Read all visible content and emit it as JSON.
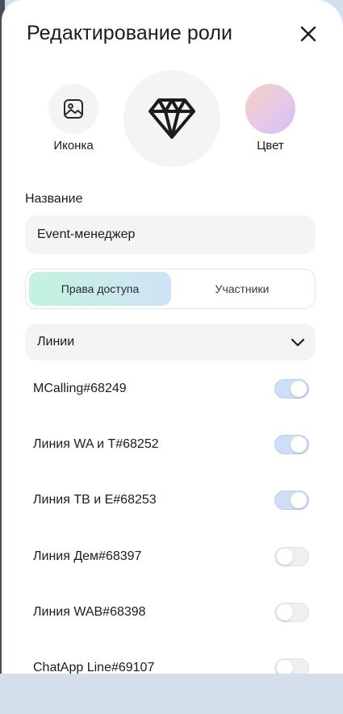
{
  "dialog": {
    "title": "Редактирование роли",
    "close_icon": "close-icon"
  },
  "appearance": {
    "icon_label": "Иконка",
    "icon_tile_icon": "image-icon",
    "main_icon": "diamond-icon",
    "color_label": "Цвет",
    "color_gradient": [
      "#f6d2bf",
      "#e6c8e8",
      "#cfc3f0"
    ]
  },
  "name_field": {
    "label": "Название",
    "value": "Event-менеджер"
  },
  "tabs": [
    {
      "label": "Права доступа",
      "active": true
    },
    {
      "label": "Участники",
      "active": false
    }
  ],
  "lines_section": {
    "label": "Линии",
    "chevron_icon": "chevron-down-icon",
    "items": [
      {
        "label": "MCalling#68249",
        "enabled": true
      },
      {
        "label": "Линия WA и T#68252",
        "enabled": true
      },
      {
        "label": "Линия ТВ и Е#68253",
        "enabled": true
      },
      {
        "label": "Линия Дем#68397",
        "enabled": false
      },
      {
        "label": "Линия WAB#68398",
        "enabled": false
      },
      {
        "label": "ChatApp Line#69107",
        "enabled": false
      }
    ]
  },
  "colors": {
    "toggle_on": "#cfdef7",
    "toggle_off": "#eeeff1",
    "active_tab_gradient": [
      "#c3f3de",
      "#cfe3f7"
    ],
    "field_background": "#f3f4f6"
  }
}
